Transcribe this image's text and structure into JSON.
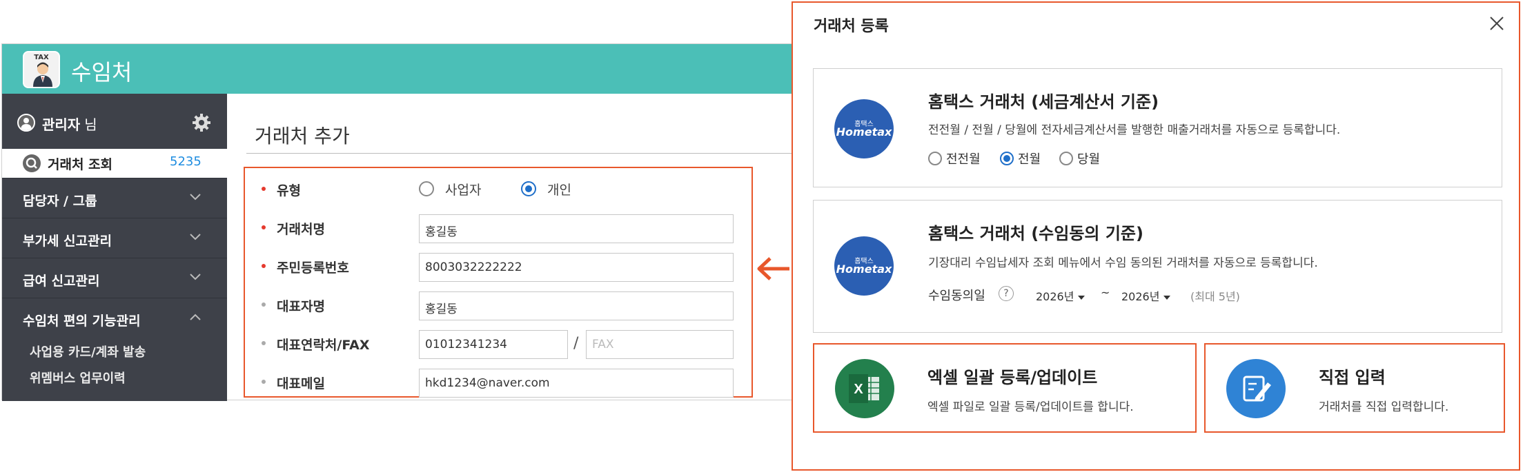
{
  "app": {
    "title": "수임처",
    "logo_text": "TAX",
    "user": {
      "name": "관리자",
      "suffix": "님"
    },
    "search": {
      "label": "거래처 조회",
      "count": "5235"
    },
    "menu": [
      {
        "label": "담당자 / 그룹"
      },
      {
        "label": "부가세 신고관리"
      },
      {
        "label": "급여 신고관리"
      },
      {
        "label": "수임처 편의 기능관리"
      }
    ],
    "submenu": [
      {
        "label": "사업용 카드/계좌 발송"
      },
      {
        "label": "위멤버스 업무이력"
      }
    ]
  },
  "form": {
    "title": "거래처 추가",
    "fields": {
      "type_label": "유형",
      "type_options": [
        "사업자",
        "개인"
      ],
      "type_selected": "개인",
      "name_label": "거래처명",
      "name_value": "홍길동",
      "rrn_label": "주민등록번호",
      "rrn_value": "8003032222222",
      "rep_label": "대표자명",
      "rep_value": "홍길동",
      "contact_label": "대표연락처/FAX",
      "contact_value": "01012341234",
      "contact_sep": "/",
      "fax_placeholder": "FAX",
      "email_label": "대표메일",
      "email_value": "hkd1234@naver.com"
    }
  },
  "dialog": {
    "title": "거래처 등록",
    "hometax_logo": {
      "top": "홈택스",
      "bottom": "Hometax"
    },
    "card1": {
      "title": "홈택스 거래처 (세금계산서 기준)",
      "desc": "전전월 / 전월 / 당월에 전자세금계산서를 발행한 매출거래처를 자동으로 등록합니다.",
      "options": [
        "전전월",
        "전월",
        "당월"
      ],
      "selected": "전월"
    },
    "card2": {
      "title": "홈택스 거래처 (수임동의 기준)",
      "desc": "기장대리 수임납세자 조회 메뉴에서 수임 동의된 거래처를 자동으로 등록합니다.",
      "period_label": "수임동의일",
      "help": "?",
      "from_year": "2026년",
      "tilde": "~",
      "to_year": "2026년",
      "note": "(최대 5년)"
    },
    "card3": {
      "title": "엑셀 일괄 등록/업데이트",
      "desc": "엑셀 파일로 일괄 등록/업데이트를 합니다.",
      "icon_text": "X"
    },
    "card4": {
      "title": "직접 입력",
      "desc": "거래처를 직접 입력합니다."
    }
  },
  "colors": {
    "header": "#4bbfb7",
    "sidebar": "#3e4149",
    "highlight": "#e8572b",
    "accent_blue": "#1f6fc9",
    "hometax_blue": "#2b5fb3",
    "excel_green": "#23804d"
  }
}
